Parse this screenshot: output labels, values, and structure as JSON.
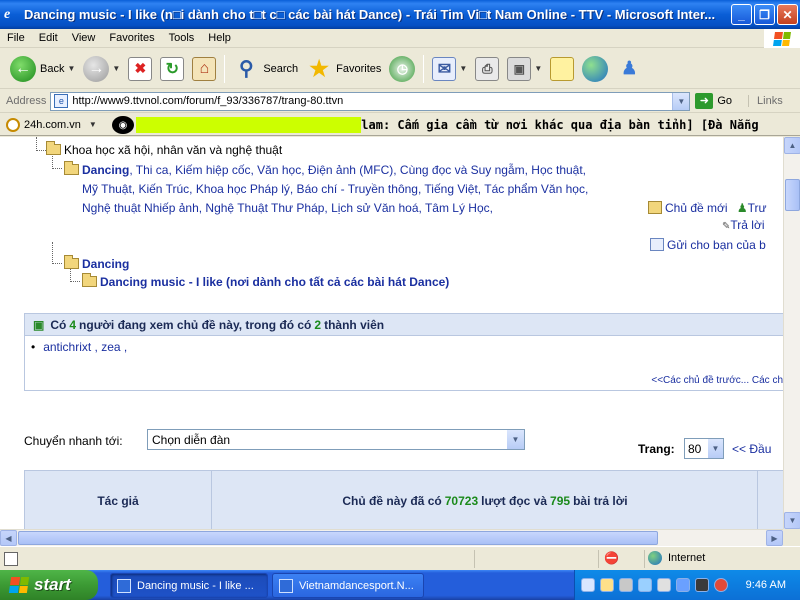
{
  "window": {
    "title": "Dancing music - I like (n□i dành cho t□t c□ các bài hát Dance) - Trái Tim Vi□t Nam Online - TTV - Microsoft Inter...",
    "min_glyph": "_",
    "max_glyph": "❐",
    "close_glyph": "✕"
  },
  "menu": [
    "File",
    "Edit",
    "View",
    "Favorites",
    "Tools",
    "Help"
  ],
  "toolbar": {
    "back_label": "Back",
    "search_label": "Search",
    "favorites_label": "Favorites"
  },
  "address": {
    "label": "Address",
    "url": "http://www9.ttvnol.com/forum/f_93/336787/trang-80.ttvn",
    "go_label": "Go",
    "links_label": "Links"
  },
  "linkbar": {
    "site": "24h.com.vn",
    "ticker": "lam: Cấm gia cầm từ nơi khác qua địa bàn tỉnh]  [Đà Nẵng"
  },
  "tree": {
    "root": "Khoa học xã hội, nhân văn và nghệ thuật",
    "forums_lead": "Dancing",
    "forums_rest": ", Thi ca, Kiếm hiệp cốc, Văn học, Điện ảnh (MFC), Cùng đọc và Suy ngẫm, Học thuật, Mỹ Thuật, Kiến Trúc, Khoa học Pháp lý, Báo chí - Truyền thông, Tiếng Việt, Tác phẩm Văn học, Nghệ thuật Nhiếp ảnh, Nghệ Thuật Thư Pháp, Lịch sử Văn hoá, Tâm Lý Học,",
    "sub": "Dancing",
    "topic": "Dancing music - I like (nơi dành cho tất cả các bài hát Dance)"
  },
  "actions": {
    "new_topic": "Chủ đề mới",
    "new_topic_tail": "Trư",
    "reply": "Trả lời",
    "send": "Gửi cho bạn của b"
  },
  "viewers": {
    "prefix": "Có",
    "total": "4",
    "middle": "người đang xem chủ đề này, trong đó có",
    "members": "2",
    "suffix": "thành viên",
    "users": "antichrixt , zea ,",
    "prev_next": "<<Các chủ đề trước...  Các ch"
  },
  "jump": {
    "label": "Chuyển nhanh tới:",
    "selected": "Chọn diễn đàn"
  },
  "paging": {
    "label": "Trang:",
    "current": "80",
    "first": "<< Đầu"
  },
  "thread_header": {
    "author": "Tác giả",
    "stats_prefix": "Chủ đề này đã có",
    "views": "70723",
    "stats_middle": "lượt đọc và",
    "replies": "795",
    "stats_suffix": "bài trả lời"
  },
  "status": {
    "zone": "Internet"
  },
  "taskbar": {
    "start": "start",
    "tasks": [
      "Dancing music - I like ...",
      "Vietnamdancesport.N..."
    ],
    "time": "9:46 AM"
  }
}
